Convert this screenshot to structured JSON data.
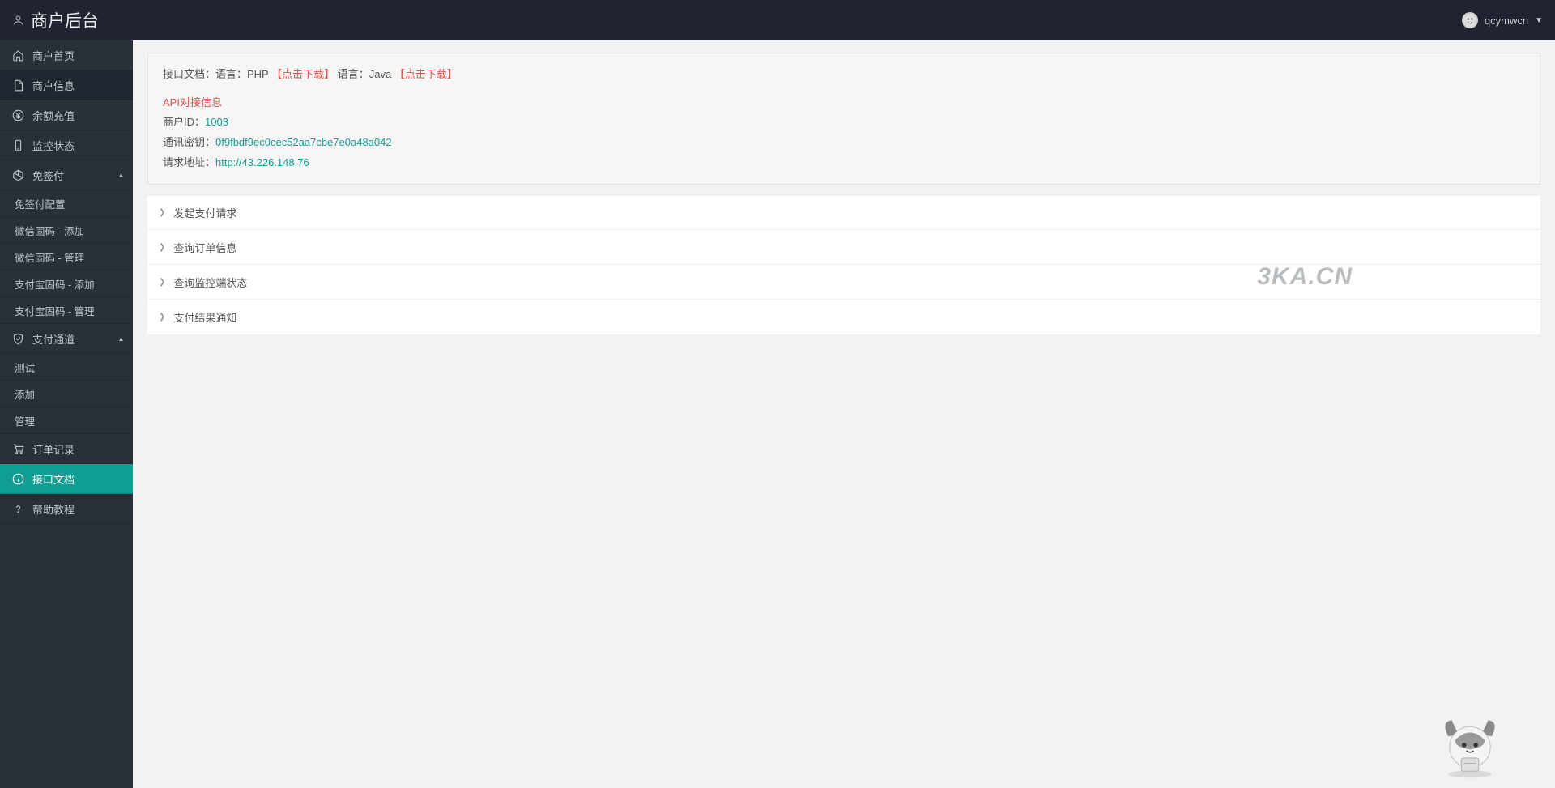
{
  "header": {
    "brand": "商户后台",
    "username": "qcymwcn"
  },
  "sidebar": {
    "home": "商户首页",
    "merchant_info": "商户信息",
    "recharge": "余额充值",
    "monitor": "监控状态",
    "nosign": {
      "title": "免签付",
      "config": "免签付配置",
      "wx_add": "微信固码 - 添加",
      "wx_manage": "微信固码 - 管理",
      "ali_add": "支付宝固码 - 添加",
      "ali_manage": "支付宝固码 - 管理"
    },
    "channel": {
      "title": "支付通道",
      "test": "测试",
      "add": "添加",
      "manage": "管理"
    },
    "orders": "订单记录",
    "api_doc": "接口文档",
    "help": "帮助教程"
  },
  "doc": {
    "line1_prefix": "接口文档：语言：PHP",
    "line1_download": "【点击下载】",
    "line1_java": "语言：Java",
    "line1_download2": "【点击下载】",
    "api_info_title": "API对接信息",
    "merchant_id_label": "商户ID：",
    "merchant_id_value": "1003",
    "secret_label": "通讯密钥：",
    "secret_value": "0f9fbdf9ec0cec52aa7cbe7e0a48a042",
    "url_label": "请求地址：",
    "url_value": "http://43.226.148.76"
  },
  "accordion": {
    "init_pay": "发起支付请求",
    "query_order": "查询订单信息",
    "query_monitor": "查询监控端状态",
    "pay_notify": "支付结果通知"
  },
  "watermark": "3KA.CN"
}
